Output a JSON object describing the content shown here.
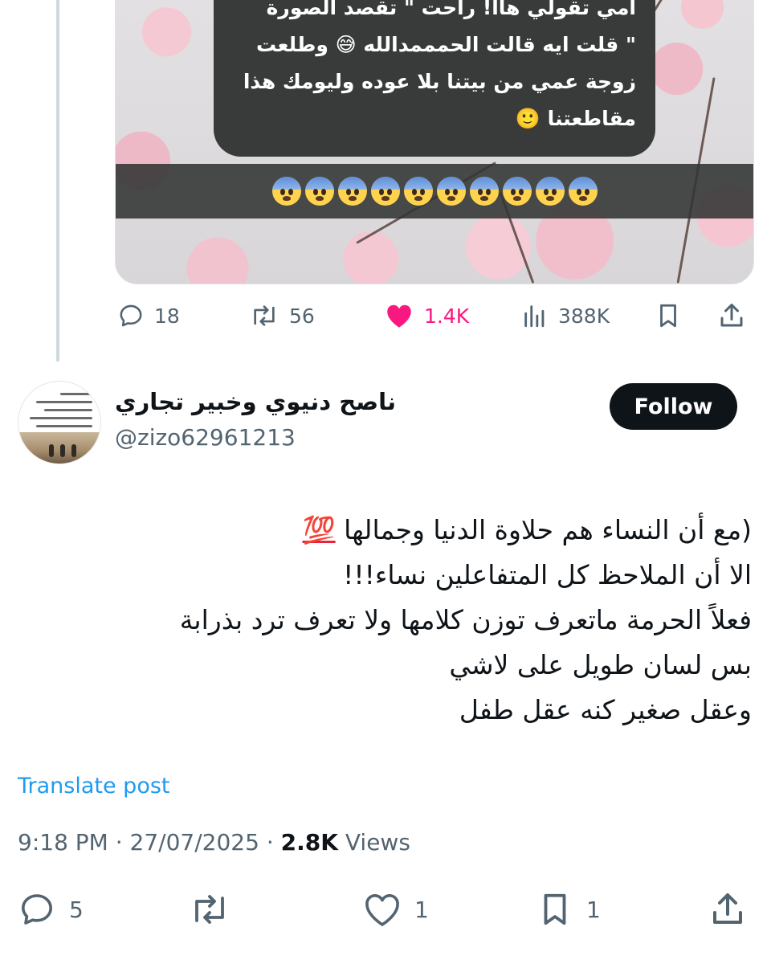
{
  "quoted_post": {
    "image_text_lines": [
      "امي  تقولي هاا! راحت  \" تقصد الصورة",
      "\" قلت ايه قالت الحمممدالله 😅  وطلعت",
      "زوجة عمي  من بيتنا بلا عوده وليومك هذا",
      "مقاطعتنا 🙂"
    ],
    "emoji_strip_count": 10,
    "stats": {
      "replies": "18",
      "reposts": "56",
      "likes": "1.4K",
      "views": "388K"
    }
  },
  "post": {
    "author_name": "ناصح دنيوي وخبير تجاري",
    "author_handle": "@zizo62961213",
    "follow_label": "Follow",
    "text_lines": [
      "(مع أن النساء هم حلاوة الدنيا وجمالها",
      "الا أن الملاحظ كل المتفاعلين نساء!!!",
      "فعلاً الحرمة ماتعرف توزن كلامها ولا تعرف ترد بذرابة",
      "بس لسان طويل على لاشي",
      "وعقل صغير كنه عقل طفل"
    ],
    "hundred_emoji": "💯",
    "translate_label": "Translate post",
    "time": "9:18 PM",
    "date": "27/07/2025",
    "separator": "·",
    "views_count": "2.8K",
    "views_label": "Views"
  },
  "actions": {
    "replies": "5",
    "reposts": "",
    "likes": "1",
    "bookmarks": "1"
  },
  "colors": {
    "like_pink": "#f91880",
    "link_blue": "#1d9bf0",
    "muted_gray": "#536471"
  }
}
